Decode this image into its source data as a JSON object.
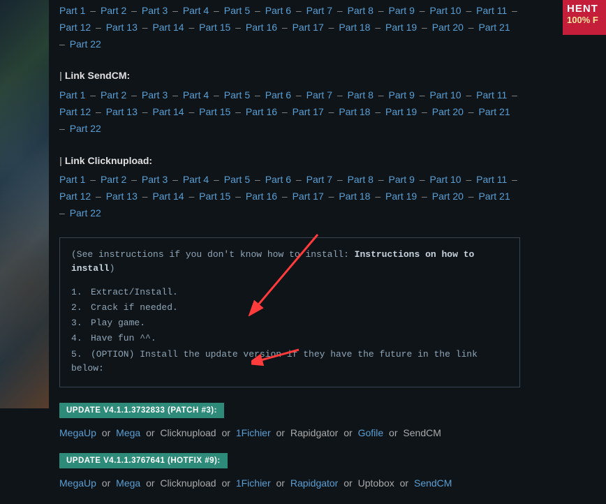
{
  "ad": {
    "line1": "HENT",
    "line2": "100% F"
  },
  "linkGroups": [
    {
      "label": "",
      "parts": 22,
      "showLabel": false
    },
    {
      "label": "Link SendCM:",
      "parts": 22,
      "showLabel": true
    },
    {
      "label": "Link Clicknupload:",
      "parts": 22,
      "showLabel": true
    }
  ],
  "partPrefix": "Part ",
  "sep": "–",
  "instructions": {
    "prefix": "(See instructions if you don't know how to install: ",
    "link": "Instructions on how to install",
    "suffix": ")",
    "steps": [
      "Extract/Install.",
      "Crack if needed.",
      "Play game.",
      "Have fun ^^.",
      "(OPTION) Install the update version if they have the future in the link below:"
    ]
  },
  "or": "or",
  "updates": [
    {
      "badge": "UPDATE V4.1.1.3732833 (PATCH #3):",
      "mirrors": [
        {
          "name": "MegaUp",
          "link": true
        },
        {
          "name": "Mega",
          "link": true
        },
        {
          "name": "Clicknupload",
          "link": false
        },
        {
          "name": "1Fichier",
          "link": true
        },
        {
          "name": "Rapidgator",
          "link": false
        },
        {
          "name": "Gofile",
          "link": true
        },
        {
          "name": "SendCM",
          "link": false
        }
      ]
    },
    {
      "badge": "UPDATE V4.1.1.3767641 (HOTFIX #9):",
      "mirrors": [
        {
          "name": "MegaUp",
          "link": true
        },
        {
          "name": "Mega",
          "link": true
        },
        {
          "name": "Clicknupload",
          "link": false
        },
        {
          "name": "1Fichier",
          "link": true
        },
        {
          "name": "Rapidgator",
          "link": true
        },
        {
          "name": "Uptobox",
          "link": false
        },
        {
          "name": "SendCM",
          "link": true
        }
      ]
    }
  ]
}
